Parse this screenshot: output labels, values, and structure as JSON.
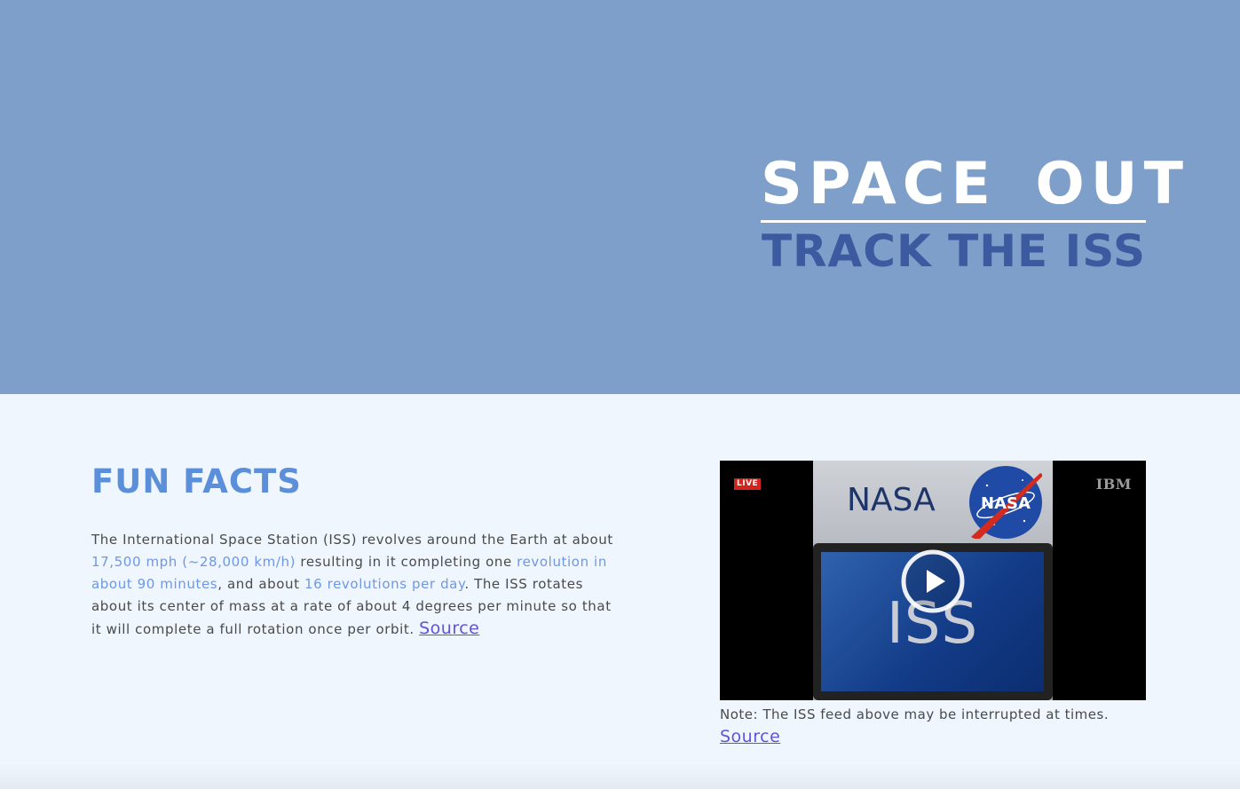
{
  "header": {
    "title": "SPACE OUT",
    "subtitle": "TRACK THE ISS"
  },
  "fun_facts": {
    "heading": "FUN FACTS",
    "text_1": "The International Space Station (ISS) revolves around the Earth at about ",
    "highlight_speed": "17,500 mph (~28,000 km/h)",
    "text_2": " resulting in it completing one ",
    "highlight_revolution": "revolution in about 90 minutes",
    "text_3": ", and about ",
    "highlight_per_day": "16 revolutions per day",
    "text_4": ". The ISS rotates about its center of mass at a rate of about 4 degrees per minute so that it will complete a full rotation once per orbit. ",
    "source_label": "Source"
  },
  "video": {
    "live_label": "LIVE",
    "nasa_label": "NASA",
    "nasa_logo_text": "NASA",
    "screen_label": "ISS",
    "ibm_label": "IBM",
    "note": "Note: The ISS feed above may be interrupted at times.",
    "source_label": "Source"
  },
  "colors": {
    "hero_background": "#7d9fca",
    "page_background": "#eff6fe",
    "subtitle": "#3b5aa0",
    "heading": "#5b8fda",
    "highlight": "#6f97e6",
    "link": "#6352d9",
    "live_badge": "#d4241b"
  },
  "icons": {
    "play": "play-circle-icon",
    "nasa_logo": "nasa-meatball-logo"
  }
}
